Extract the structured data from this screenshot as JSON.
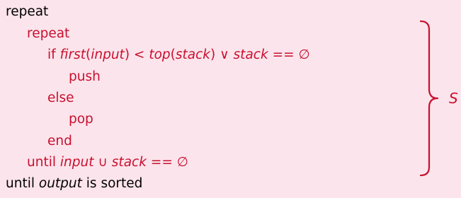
{
  "accent_color": "#c8102e",
  "background_color": "#fce4ec",
  "outer_repeat": "repeat",
  "inner_repeat": "repeat",
  "if_line": {
    "kw": "if",
    "first": "first",
    "lparen1": "(",
    "input1": "input",
    "rparen1": ")",
    "lt": "<",
    "top": "top",
    "lparen2": "(",
    "stack1": "stack",
    "rparen2": ")",
    "or": "∨",
    "stack2": "stack",
    "eq": "==",
    "empty": "∅"
  },
  "push": "push",
  "else": "else",
  "pop": "pop",
  "end": "end",
  "until_inner": {
    "kw": "until",
    "input": "input",
    "union": "∪",
    "stack": "stack",
    "eq": "==",
    "empty": "∅"
  },
  "until_outer": {
    "kw": "until",
    "output": "output",
    "rest": "is sorted"
  },
  "brace_label": "S"
}
